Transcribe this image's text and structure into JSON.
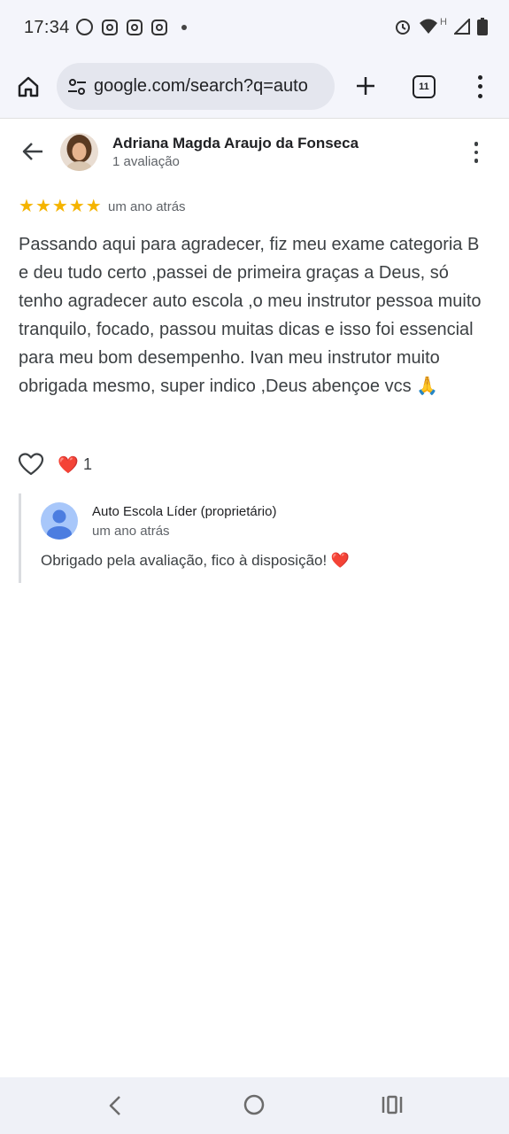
{
  "status_bar": {
    "time": "17:34",
    "icons_left": [
      "whatsapp-icon",
      "instagram-icon",
      "instagram-icon",
      "instagram-icon",
      "notification-dot"
    ],
    "icons_right": [
      "alarm-icon",
      "wifi-icon",
      "signal-h-icon",
      "battery-icon"
    ],
    "network_label": "H"
  },
  "browser": {
    "url": "google.com/search?q=auto",
    "tab_count": "11",
    "icons": [
      "home-icon",
      "site-settings-icon",
      "plus-icon",
      "tabs-icon",
      "more-vert-icon"
    ]
  },
  "review": {
    "reviewer_name": "Adriana Magda Araujo da Fonseca",
    "reviewer_meta": "1 avaliação",
    "rating": 5,
    "star_glyph": "★",
    "date": "um ano atrás",
    "text": "Passando aqui para agradecer, fiz meu exame categoria B e deu tudo certo ,passei de primeira graças a Deus, só tenho agradecer auto escola ,o meu instrutor pessoa muito tranquilo, focado, passou muitas dicas e isso foi essencial para meu bom desempenho. Ivan meu instrutor muito obrigada mesmo, super indico ,Deus abençoe vcs 🙏",
    "reaction_emoji": "❤️",
    "reaction_count": "1"
  },
  "owner_reply": {
    "name": "Auto Escola Líder (proprietário)",
    "date": "um ano atrás",
    "text": "Obrigado pela avaliação, fico à disposição! ❤️"
  },
  "colors": {
    "star": "#f5b400",
    "chrome_bg": "#f4f5fb",
    "url_bg": "#e4e6ee",
    "owner_avatar": "#a8c7fa",
    "owner_avatar_figure": "#4c7de0"
  }
}
